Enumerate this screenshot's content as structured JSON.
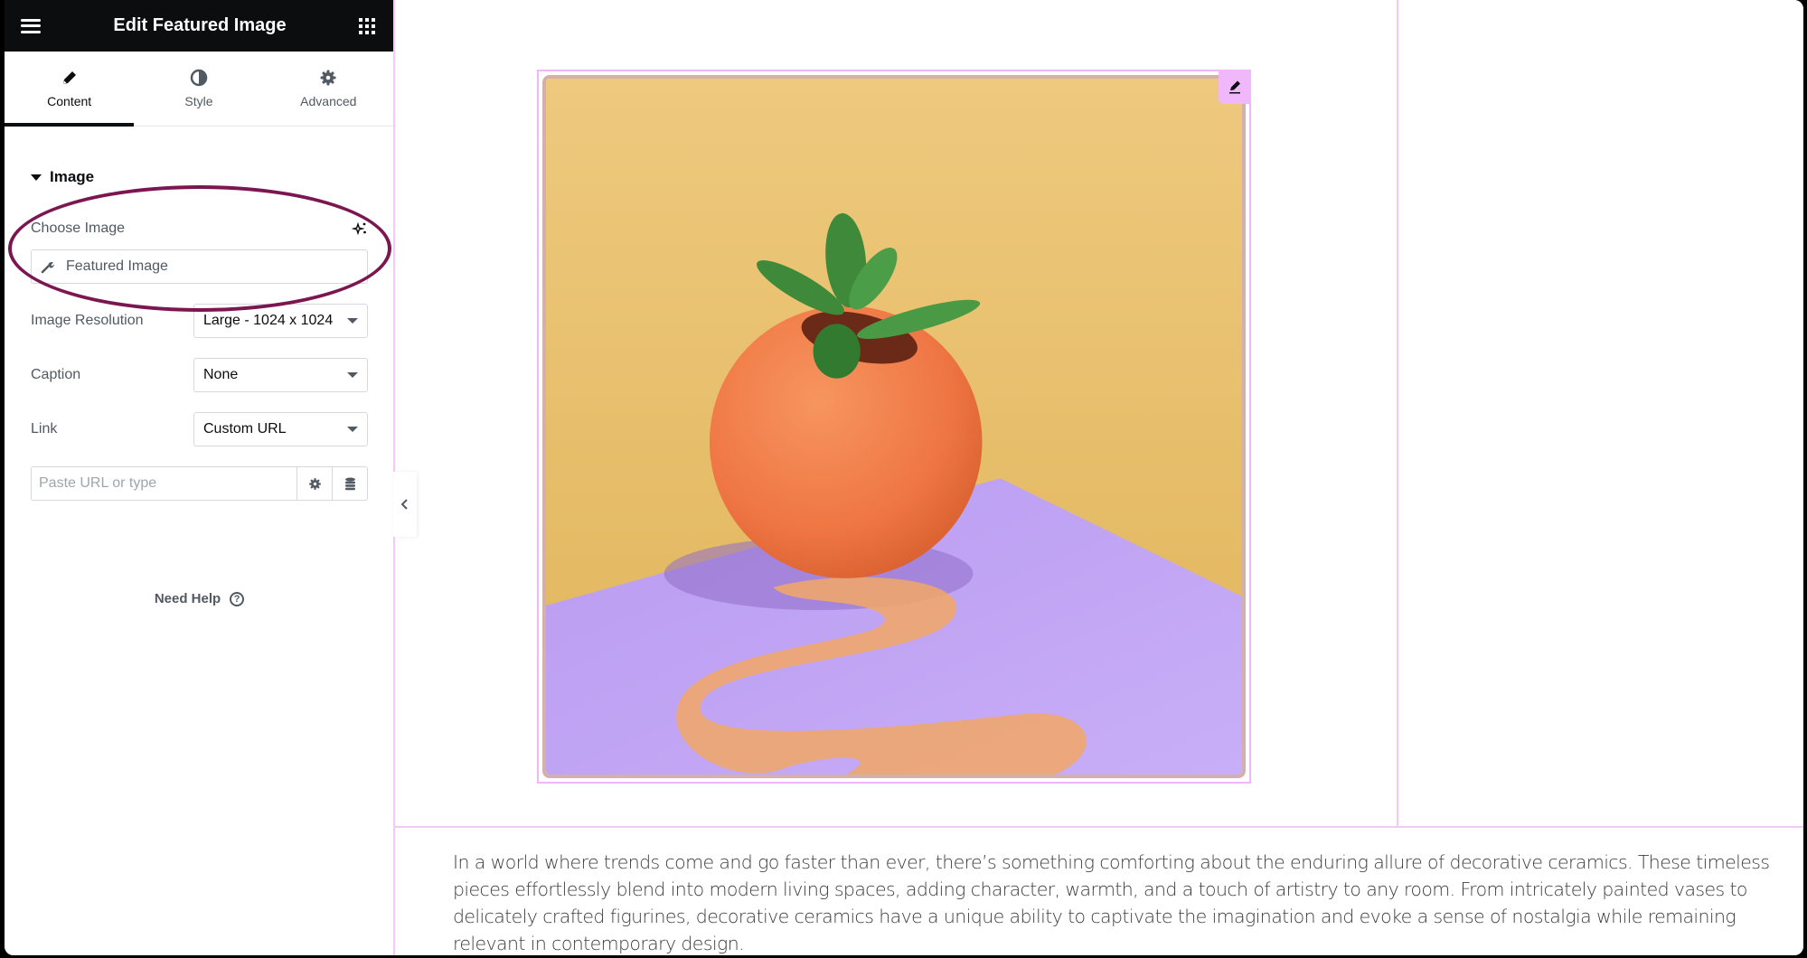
{
  "panel": {
    "title": "Edit Featured Image",
    "tabs": [
      {
        "label": "Content",
        "icon": "pencil-icon",
        "active": true
      },
      {
        "label": "Style",
        "icon": "half-circle-icon",
        "active": false
      },
      {
        "label": "Advanced",
        "icon": "gear-icon",
        "active": false
      }
    ],
    "section_title": "Image",
    "choose_image": {
      "label": "Choose Image",
      "dynamic_value": "Featured Image"
    },
    "image_resolution": {
      "label": "Image Resolution",
      "value": "Large - 1024 x 1024"
    },
    "caption": {
      "label": "Caption",
      "value": "None"
    },
    "link": {
      "label": "Link",
      "value": "Custom URL"
    },
    "url_input": {
      "placeholder": "Paste URL or type",
      "value": ""
    },
    "need_help": "Need Help",
    "help_glyph": "?"
  },
  "canvas": {
    "image_alt": "Orange spherical ceramic pot with a jade plant on a purple surface against a mustard-yellow wall",
    "paragraph": "In a world where trends come and go faster than ever, there’s something comforting about the enduring allure of decorative ceramics. These timeless pieces effortlessly blend into modern living spaces, adding character, warmth, and a touch of artistry to any room. From intricately painted vases to delicately crafted figurines, decorative ceramics have a unique ability to captivate the imagination and evoke a sense of nostalgia while remaining relevant in contemporary design."
  },
  "colors": {
    "header_bg": "#0c0d0e",
    "editor_outline": "#f0b8fa",
    "annotation_ellipse": "#7b1651",
    "wall": "#e8be6a",
    "table": "#c4a6f5",
    "pot": "#f07a4a",
    "plant": "#3e8a3a"
  }
}
